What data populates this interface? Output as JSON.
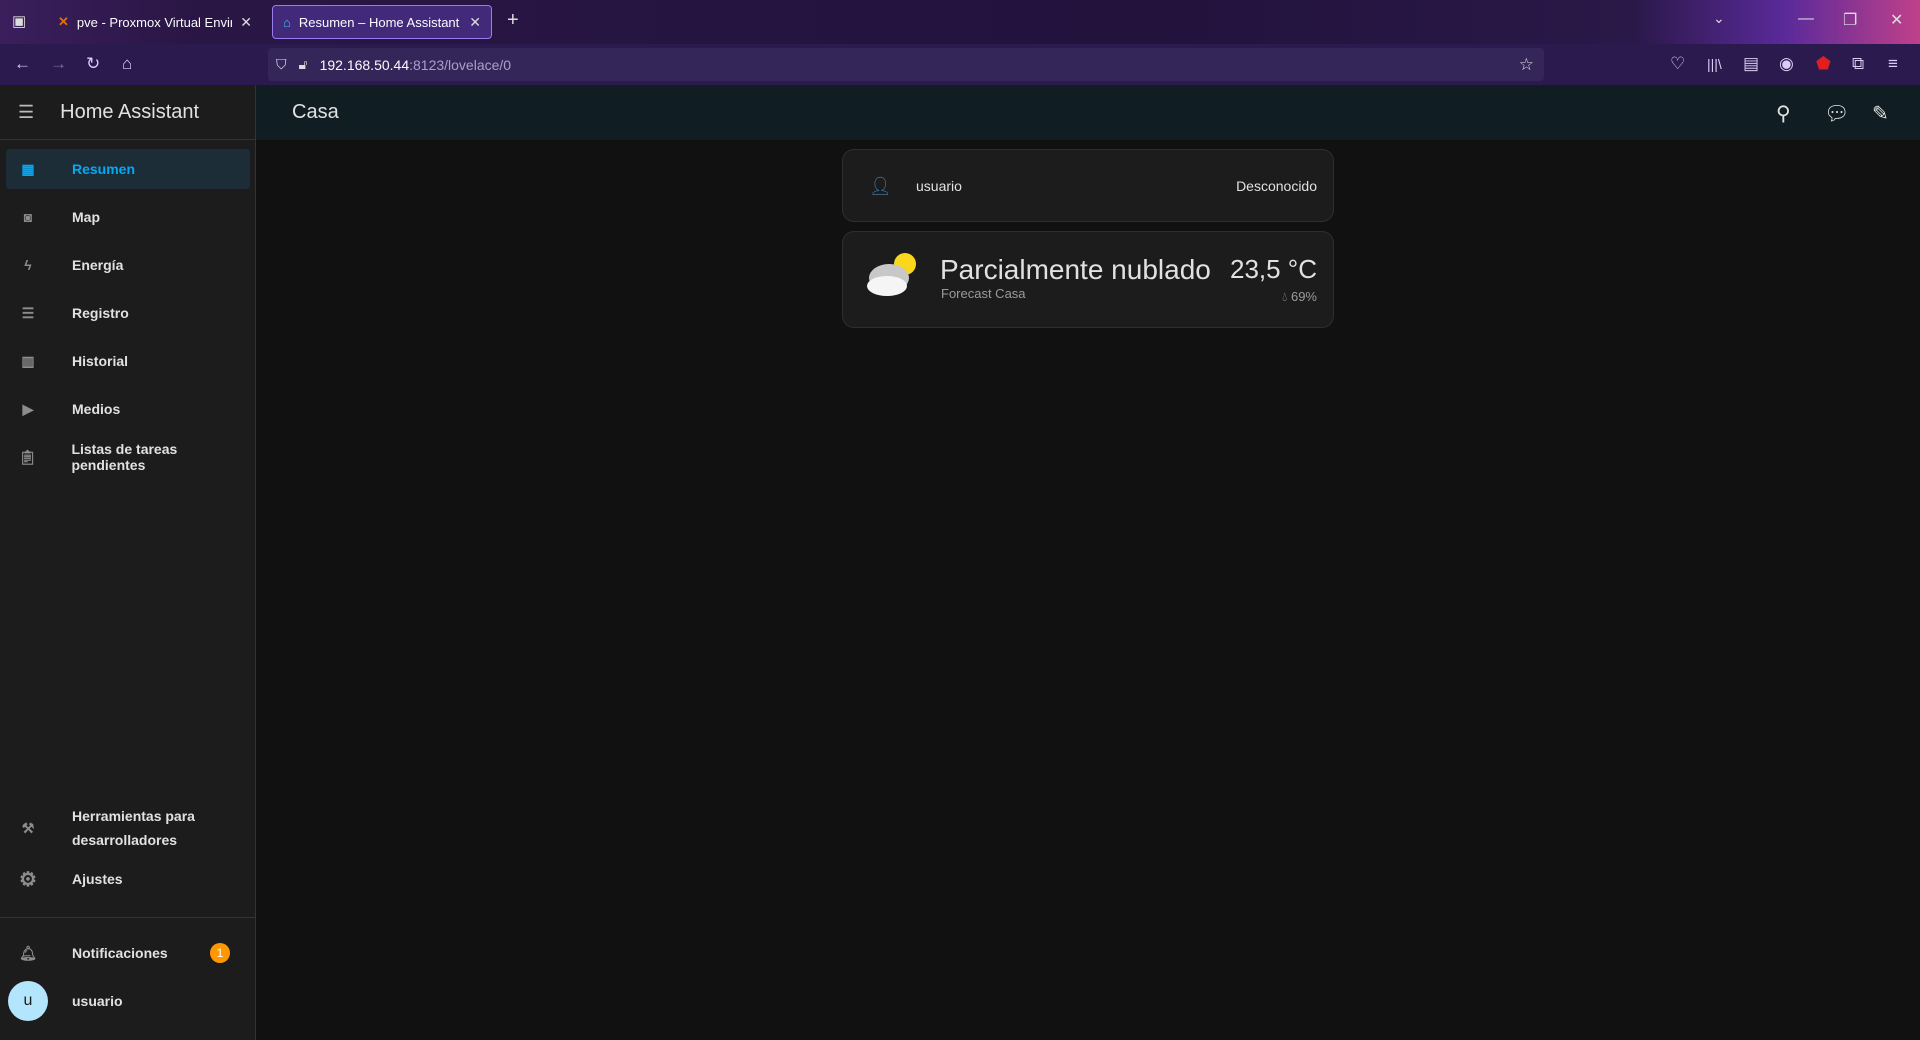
{
  "browser": {
    "tabs": [
      {
        "title": "pve - Proxmox Virtual Environm",
        "active": false
      },
      {
        "title": "Resumen – Home Assistant",
        "active": true
      }
    ],
    "url_host": "192.168.50.44",
    "url_path": ":8123/lovelace/0"
  },
  "app": {
    "title": "Home Assistant",
    "page_title": "Casa"
  },
  "sidebar": {
    "items": [
      {
        "label": "Resumen",
        "icon": "dashboard-icon",
        "active": true
      },
      {
        "label": "Map",
        "icon": "map-account-icon"
      },
      {
        "label": "Energía",
        "icon": "lightning-icon"
      },
      {
        "label": "Registro",
        "icon": "list-icon"
      },
      {
        "label": "Historial",
        "icon": "chart-box-icon"
      },
      {
        "label": "Medios",
        "icon": "media-play-icon"
      },
      {
        "label": "Listas de tareas pendientes",
        "icon": "clipboard-list-icon"
      }
    ],
    "tools_line1": "Herramientas para",
    "tools_line2": "desarrolladores",
    "settings": "Ajustes",
    "notifications": "Notificaciones",
    "notifications_count": "1",
    "user_initial": "u",
    "user": "usuario"
  },
  "cards": {
    "person": {
      "name": "usuario",
      "state": "Desconocido"
    },
    "weather": {
      "condition": "Parcialmente nublado",
      "name": "Forecast Casa",
      "temperature": "23,5 °C",
      "humidity": "69%"
    }
  },
  "colors": {
    "accent": "#03a9f4",
    "badge": "#ff9800",
    "avatar": "#b3e5fc"
  }
}
